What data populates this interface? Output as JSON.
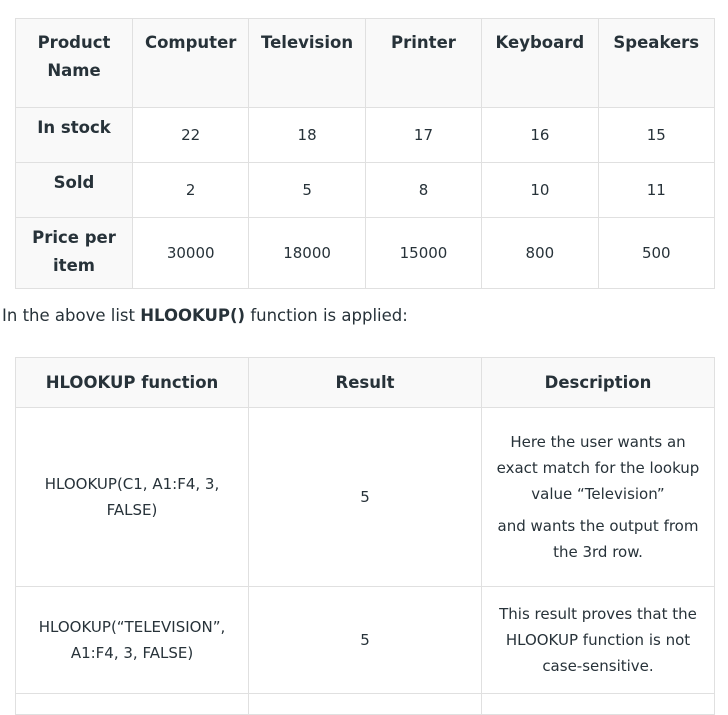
{
  "product_table": {
    "headers": [
      "Product Name",
      "Computer",
      "Television",
      "Printer",
      "Keyboard",
      "Speakers"
    ],
    "rows": [
      {
        "label": "In stock",
        "values": [
          "22",
          "18",
          "17",
          "16",
          "15"
        ]
      },
      {
        "label": "Sold",
        "values": [
          "2",
          "5",
          "8",
          "10",
          "11"
        ]
      },
      {
        "label": "Price per item",
        "values": [
          "30000",
          "18000",
          "15000",
          "800",
          "500"
        ]
      }
    ]
  },
  "intro": {
    "before": "In the above list ",
    "bold": "HLOOKUP()",
    "after": " function is applied:"
  },
  "function_table": {
    "headers": [
      "HLOOKUP function",
      "Result",
      "Description"
    ],
    "rows": [
      {
        "function": "HLOOKUP(C1, A1:F4, 3, FALSE)",
        "result": "5",
        "description": [
          "Here the user wants an exact match for the lookup value “Television”",
          "and wants the output from the 3rd row."
        ]
      },
      {
        "function": "HLOOKUP(“TELEVISION”, A1:F4, 3, FALSE)",
        "result": "5",
        "description": [
          "This result proves that the HLOOKUP function is not case-sensitive."
        ]
      }
    ]
  }
}
